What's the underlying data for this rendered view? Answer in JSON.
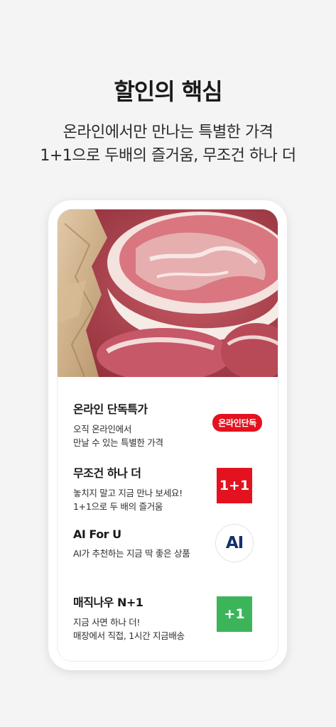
{
  "header": {
    "title": "할인의 핵심",
    "subtitle_line1": "온라인에서만 만나는 특별한 가격",
    "subtitle_line2": "1+1으로 두배의 즐거움, 무조건 하나 더"
  },
  "features": [
    {
      "title": "온라인 단독특가",
      "desc_line1": "오직 온라인에서",
      "desc_line2": "만날 수 있는 특별한 가격",
      "badge": "온라인단독",
      "badge_color": "#e3121e"
    },
    {
      "title": "무조건 하나 더",
      "desc_line1": "놓치지 말고 지금 만나 보세요!",
      "desc_line2": "1+1으로 두 배의 즐거움",
      "badge": "1+1",
      "badge_color": "#e3121e"
    },
    {
      "title": "AI For U",
      "desc_line1": "AI가 추천하는 지금 딱 좋은 상품",
      "badge": "AI",
      "badge_color": "#14306e"
    },
    {
      "title": "매직나우 N+1",
      "desc_line1": "지금 사면 하나 더!",
      "desc_line2": "매장에서 직접, 1시간 지금배송",
      "badge": "+1",
      "badge_color": "#3cb55a"
    }
  ],
  "hero_image": {
    "icon": "pork-meat-photo"
  }
}
